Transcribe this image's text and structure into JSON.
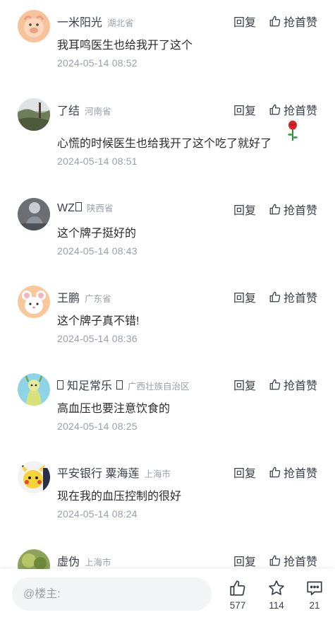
{
  "comments": [
    {
      "name": "一米阳光",
      "region": "湖北省",
      "text": "我耳鸣医生也给我开了这个",
      "time": "2024-05-14 08:52",
      "reply": "回复",
      "like": "抢首赞"
    },
    {
      "name": "了结",
      "region": "河南省",
      "text": "心慌的时候医生也给我开了这个吃了就好了",
      "time": "2024-05-14 08:51",
      "reply": "回复",
      "like": "抢首赞",
      "emoji": "rose-emoji"
    },
    {
      "name": "WZ",
      "region": "陕西省",
      "text": "这个牌子挺好的",
      "time": "2024-05-14 08:43",
      "reply": "回复",
      "like": "抢首赞"
    },
    {
      "name": "王鹏",
      "region": "广东省",
      "text": "这个牌子真不错!",
      "time": "2024-05-14 08:36",
      "reply": "回复",
      "like": "抢首赞"
    },
    {
      "name": "知足常乐",
      "region": "广西壮族自治区",
      "text": "高血压也要注意饮食的",
      "time": "2024-05-14 08:25",
      "reply": "回复",
      "like": "抢首赞"
    },
    {
      "name": "平安银行 粟海莲",
      "region": "上海市",
      "text": "现在我的血压控制的很好",
      "time": "2024-05-14 08:24",
      "reply": "回复",
      "like": "抢首赞"
    },
    {
      "name": "虚伪",
      "region": "上海市",
      "text": "",
      "time": "",
      "reply": "回复",
      "like": "抢首赞"
    }
  ],
  "bottom_bar": {
    "input_placeholder": "@楼主:",
    "like_count": "577",
    "star_count": "114",
    "comment_count": "21"
  },
  "icons": {
    "like": "thumb-up-icon",
    "star": "star-icon",
    "comment": "comment-icon"
  }
}
